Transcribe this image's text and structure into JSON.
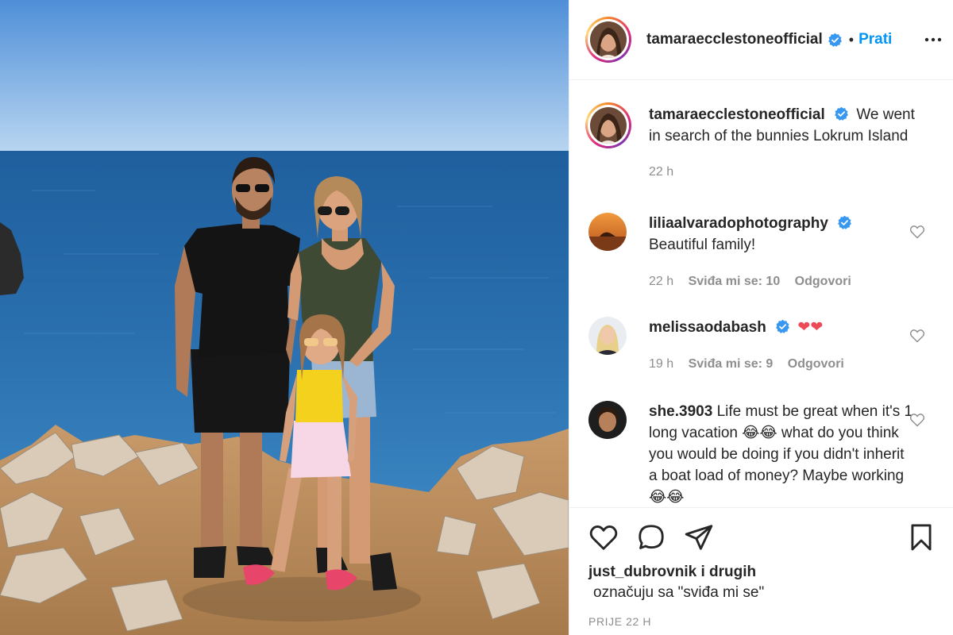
{
  "post": {
    "username": "tamaraecclestoneofficial",
    "separator": "•",
    "follow_label": "Prati",
    "caption": "We went in search of the bunnies Lokrum Island",
    "caption_time": "22 h"
  },
  "comments": [
    {
      "username": "liliaalvaradophotography",
      "verified": true,
      "text": "Beautiful family!",
      "time": "22 h",
      "likes": "Sviđa mi se: 10",
      "reply": "Odgovori"
    },
    {
      "username": "melissaodabash",
      "verified": true,
      "text": "❤❤",
      "time": "19 h",
      "likes": "Sviđa mi se: 9",
      "reply": "Odgovori"
    },
    {
      "username": "she.3903",
      "verified": false,
      "text": "Life must be great when it's 1 long vacation 😂😂 what do you think you would be doing if you didn't inherit a boat load of money? Maybe working 😂😂"
    }
  ],
  "footer": {
    "liked_by": "just_dubrovnik i drugih",
    "liked_sub": "označuju sa \"sviđa mi se\"",
    "time_ago": "PRIJE 22 H"
  },
  "icons": {
    "more": "more-icon",
    "like": "heart-icon",
    "comment": "comment-icon",
    "share": "share-icon",
    "save": "bookmark-icon",
    "verified": "verified-badge-icon"
  },
  "colors": {
    "link": "#0095f6",
    "verified": "#3897f0",
    "muted": "#8e8e8e",
    "heart_red": "#ed4956"
  }
}
